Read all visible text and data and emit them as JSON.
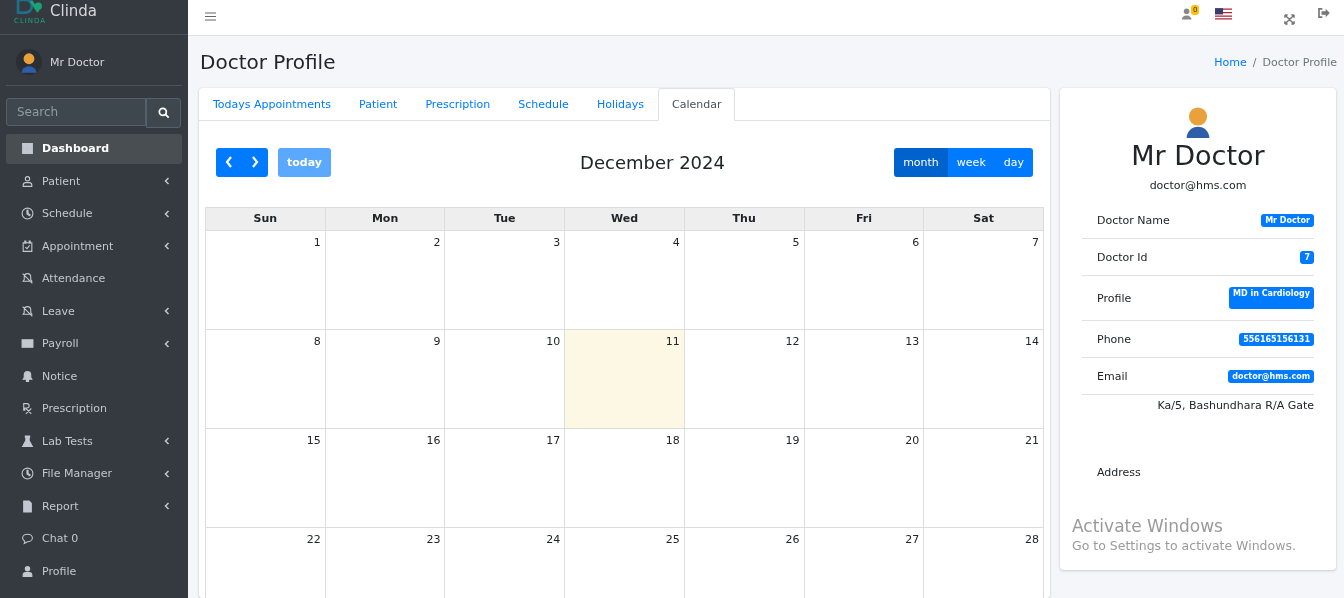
{
  "brand": {
    "name": "Clinda",
    "logo_caption": "CLINDA"
  },
  "user": {
    "name": "Mr Doctor"
  },
  "search": {
    "placeholder": "Search"
  },
  "sidebar": {
    "items": [
      {
        "label": "Dashboard",
        "selected": true,
        "has_submenu": false
      },
      {
        "label": "Patient",
        "selected": false,
        "has_submenu": true
      },
      {
        "label": "Schedule",
        "selected": false,
        "has_submenu": true
      },
      {
        "label": "Appointment",
        "selected": false,
        "has_submenu": true
      },
      {
        "label": "Attendance",
        "selected": false,
        "has_submenu": false
      },
      {
        "label": "Leave",
        "selected": false,
        "has_submenu": true
      },
      {
        "label": "Payroll",
        "selected": false,
        "has_submenu": true
      },
      {
        "label": "Notice",
        "selected": false,
        "has_submenu": false
      },
      {
        "label": "Prescription",
        "selected": false,
        "has_submenu": false
      },
      {
        "label": "Lab Tests",
        "selected": false,
        "has_submenu": true
      },
      {
        "label": "File Manager",
        "selected": false,
        "has_submenu": true
      },
      {
        "label": "Report",
        "selected": false,
        "has_submenu": true
      },
      {
        "label": "Chat 0",
        "selected": false,
        "has_submenu": false
      },
      {
        "label": "Profile",
        "selected": false,
        "has_submenu": false
      }
    ]
  },
  "topbar": {
    "notification_count": "0"
  },
  "page": {
    "title": "Doctor Profile",
    "breadcrumb_separator": "/",
    "breadcrumb": [
      {
        "label": "Home",
        "link": true
      },
      {
        "label": "Doctor Profile",
        "link": false
      }
    ]
  },
  "tabs": [
    {
      "label": "Todays Appointments",
      "selected": false
    },
    {
      "label": "Patient",
      "selected": false
    },
    {
      "label": "Prescription",
      "selected": false
    },
    {
      "label": "Schedule",
      "selected": false
    },
    {
      "label": "Holidays",
      "selected": false
    },
    {
      "label": "Calendar",
      "selected": true
    }
  ],
  "calendar": {
    "title": "December 2024",
    "today_label": "today",
    "views": [
      {
        "label": "month",
        "selected": true
      },
      {
        "label": "week",
        "selected": false
      },
      {
        "label": "day",
        "selected": false
      }
    ],
    "weekdays": [
      "Sun",
      "Mon",
      "Tue",
      "Wed",
      "Thu",
      "Fri",
      "Sat"
    ],
    "weeks": [
      [
        {
          "day": "1",
          "today": false
        },
        {
          "day": "2",
          "today": false
        },
        {
          "day": "3",
          "today": false
        },
        {
          "day": "4",
          "today": false
        },
        {
          "day": "5",
          "today": false
        },
        {
          "day": "6",
          "today": false
        },
        {
          "day": "7",
          "today": false
        }
      ],
      [
        {
          "day": "8",
          "today": false
        },
        {
          "day": "9",
          "today": false
        },
        {
          "day": "10",
          "today": false
        },
        {
          "day": "11",
          "today": true
        },
        {
          "day": "12",
          "today": false
        },
        {
          "day": "13",
          "today": false
        },
        {
          "day": "14",
          "today": false
        }
      ],
      [
        {
          "day": "15",
          "today": false
        },
        {
          "day": "16",
          "today": false
        },
        {
          "day": "17",
          "today": false
        },
        {
          "day": "18",
          "today": false
        },
        {
          "day": "19",
          "today": false
        },
        {
          "day": "20",
          "today": false
        },
        {
          "day": "21",
          "today": false
        }
      ],
      [
        {
          "day": "22",
          "today": false
        },
        {
          "day": "23",
          "today": false
        },
        {
          "day": "24",
          "today": false
        },
        {
          "day": "25",
          "today": false
        },
        {
          "day": "26",
          "today": false
        },
        {
          "day": "27",
          "today": false
        },
        {
          "day": "28",
          "today": false
        }
      ]
    ]
  },
  "profile": {
    "name": "Mr Doctor",
    "email": "doctor@hms.com",
    "fields": [
      {
        "label": "Doctor Name",
        "value": "Mr Doctor",
        "kind": "badge"
      },
      {
        "label": "Doctor Id",
        "value": "7",
        "kind": "badge"
      },
      {
        "label": "Profile",
        "value": "MD in Cardiology",
        "kind": "tall-badge"
      },
      {
        "label": "Phone",
        "value": "556165156131",
        "kind": "badge"
      },
      {
        "label": "Email",
        "value": "doctor@hms.com",
        "kind": "badge"
      },
      {
        "label": "Address",
        "value": "Ka/5, Bashundhara R/A Gate",
        "kind": "text"
      }
    ]
  },
  "os_notice": {
    "title": "Activate Windows",
    "subtitle": "Go to Settings to activate Windows."
  }
}
